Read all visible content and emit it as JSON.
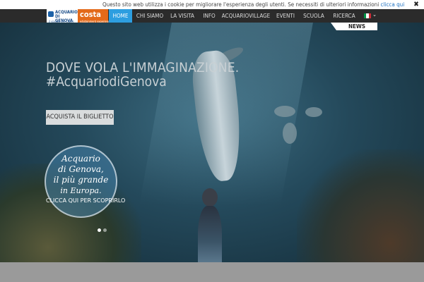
{
  "cookie_bar": {
    "text": "Questo sito web utilizza i cookie per migliorare l'esperienza degli utenti. Se necessiti di ulteriori informazioni",
    "link": "clicca qui",
    "close": "✖"
  },
  "logos": {
    "acquario_line1": "ACQUARIO",
    "acquario_line2": "DI GENOVA",
    "acquario_tagline": "il viaggio per capire",
    "costa_name": "costa",
    "costa_tagline": "edutainment experience"
  },
  "nav": {
    "items": [
      {
        "label": "HOME",
        "active": true
      },
      {
        "label": "CHI SIAMO",
        "active": false
      },
      {
        "label": "LA VISITA",
        "active": false
      },
      {
        "label": "INFO",
        "active": false
      },
      {
        "label": "ACQUARIOVILLAGE",
        "active": false
      },
      {
        "label": "EVENTI",
        "active": false
      },
      {
        "label": "SCUOLA",
        "active": false
      },
      {
        "label": "RICERCA",
        "active": false
      }
    ],
    "language_chevron": "⌄",
    "flag_colors": [
      "#009246",
      "#ffffff",
      "#ce2b37"
    ]
  },
  "news_tab": "NEWS",
  "hero": {
    "headline_line1": "DOVE VOLA L'IMMAGINAZIONE.",
    "headline_line2": "#AcquariodiGenova",
    "cta": "ACQUISTA IL BIGLIETTO",
    "badge": {
      "line1": "Acquario",
      "line2": "di Genova,",
      "line3": "il più grande",
      "line4": "in Europa.",
      "line5": "CLICCA QUI PER SCOPRIRLO"
    },
    "slides": {
      "total": 2,
      "current": 1
    }
  },
  "colors": {
    "accent": "#2d9ee0",
    "nav_bg": "#2b2b2b",
    "costa_orange": "#e36a1a"
  }
}
